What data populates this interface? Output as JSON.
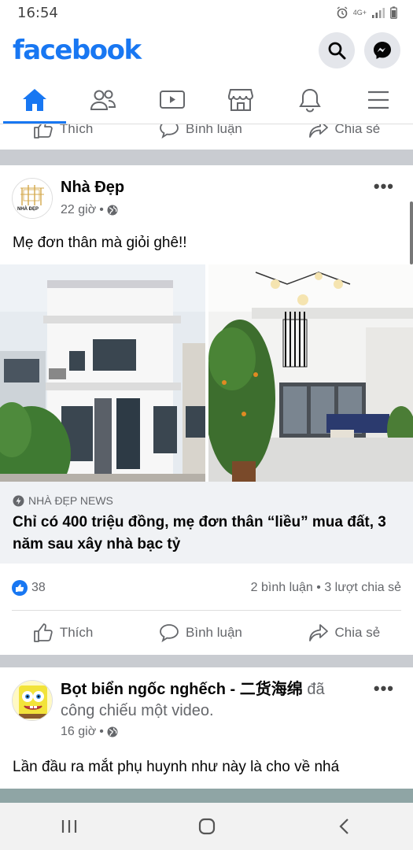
{
  "status_bar": {
    "time": "16:54",
    "network": "4G+"
  },
  "app": {
    "logo": "facebook",
    "brand_color": "#1877f2"
  },
  "header_actions": [
    {
      "icon": "search-icon"
    },
    {
      "icon": "messenger-icon"
    }
  ],
  "nav_tabs": [
    {
      "icon": "home-icon",
      "active": true
    },
    {
      "icon": "friends-icon",
      "active": false
    },
    {
      "icon": "watch-icon",
      "active": false
    },
    {
      "icon": "marketplace-icon",
      "active": false
    },
    {
      "icon": "notifications-icon",
      "active": false
    },
    {
      "icon": "menu-icon",
      "active": false
    }
  ],
  "previous_post_actions": {
    "like": "Thích",
    "comment": "Bình luận",
    "share": "Chia sẻ"
  },
  "post1": {
    "author": "Nhà Đẹp",
    "avatar_text": "NHÀ ĐẸP",
    "time": "22 giờ",
    "separator": "•",
    "caption": "Mẹ đơn thân mà giỏi ghê!!",
    "link_source": "NHÀ ĐẸP NEWS",
    "link_title": "Chỉ có 400 triệu đồng, mẹ đơn thân “liều” mua đất, 3 năm sau xây nhà bạc tỷ",
    "reaction_count": "38",
    "stats": "2 bình luận • 3 lượt chia sẻ",
    "actions": {
      "like": "Thích",
      "comment": "Bình luận",
      "share": "Chia sẻ"
    }
  },
  "post2": {
    "author": "Bọt biển ngốc nghếch - 二货海绵",
    "action_text": "đã công chiếu một video.",
    "time": "16 giờ",
    "separator": "•",
    "caption": "Lần đầu ra mắt phụ huynh như này là cho về nhá"
  },
  "system_nav": [
    {
      "icon": "recent-apps-icon"
    },
    {
      "icon": "home-circle-icon"
    },
    {
      "icon": "back-icon"
    }
  ]
}
